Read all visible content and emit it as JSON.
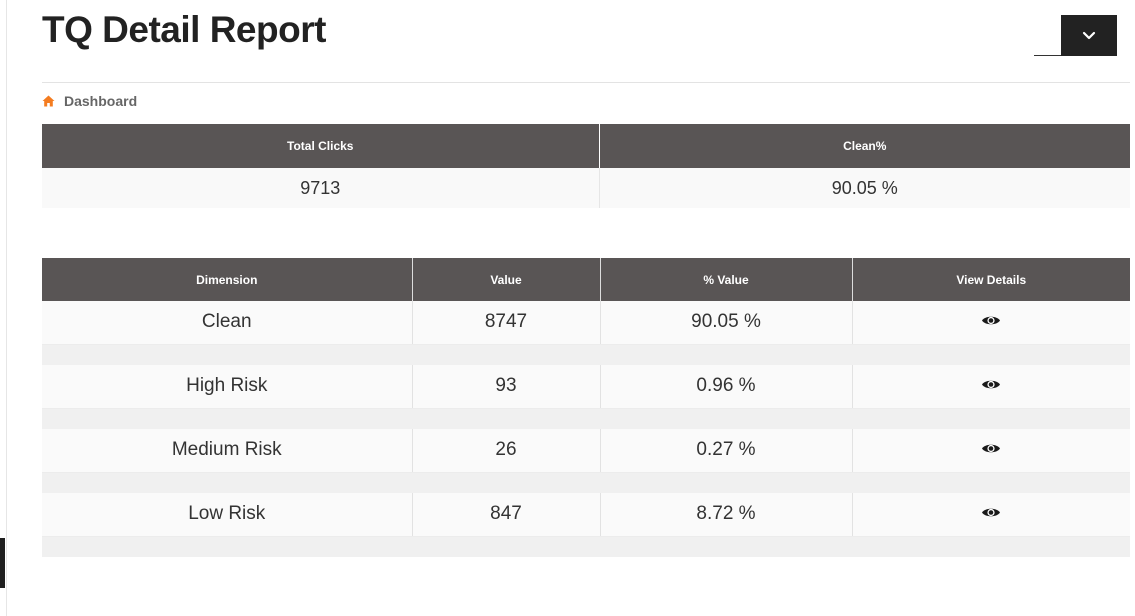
{
  "header": {
    "title": "TQ Detail Report",
    "toggle_icon": "chevron-down-icon"
  },
  "breadcrumb": {
    "icon": "home-icon",
    "icon_color": "#f47c20",
    "label": "Dashboard"
  },
  "summary": {
    "headers": [
      "Total Clicks",
      "Clean%"
    ],
    "values": [
      "9713",
      "90.05 %"
    ]
  },
  "details": {
    "headers": [
      "Dimension",
      "Value",
      "% Value",
      "View Details"
    ],
    "rows": [
      {
        "dimension": "Clean",
        "value": "8747",
        "percent": "90.05 %",
        "action_icon": "eye-icon"
      },
      {
        "dimension": "High Risk",
        "value": "93",
        "percent": "0.96 %",
        "action_icon": "eye-icon"
      },
      {
        "dimension": "Medium Risk",
        "value": "26",
        "percent": "0.27 %",
        "action_icon": "eye-icon"
      },
      {
        "dimension": "Low Risk",
        "value": "847",
        "percent": "8.72 %",
        "action_icon": "eye-icon"
      }
    ]
  },
  "colors": {
    "header_background": "#595555",
    "accent": "#f47c20",
    "toggle_background": "#222222"
  }
}
